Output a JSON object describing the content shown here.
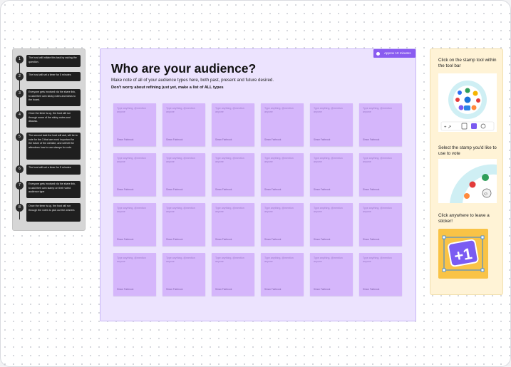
{
  "steps": [
    {
      "num": "1",
      "text": "The host will initiate this task by asking the question."
    },
    {
      "num": "2",
      "text": "The host will set a timer for 5 minutes"
    },
    {
      "num": "3",
      "text": "Everyone gets involved via the share link, to add their own sticky notes and ideas to the board."
    },
    {
      "num": "4",
      "text": "Once the timer is up, the host will run through some of the sticky notes and discuss."
    },
    {
      "num": "5",
      "text": "The second task the host will ask, will be to vote for the 3 that are most important for the future of the website, and will tell the attendees how to use stamps for vote."
    },
    {
      "num": "6",
      "text": "The host will set a timer for 5 minutes"
    },
    {
      "num": "7",
      "text": "Everyone gets involved via the share link, to add their own stamp on their voted audience type"
    },
    {
      "num": "8",
      "text": "Once the timer is up, the host will run through the votes to pick out the winners"
    }
  ],
  "frame": {
    "timer_label": "Approx 10 minutes",
    "title": "Who are your audience?",
    "subtitle": "Make note of all of your audience types here, both past, present and future desired.",
    "subtitle2": "Don't worry about refining just yet, make a list of ALL types"
  },
  "sticky": {
    "placeholder": "Type anything, @mention anyone",
    "author": "Simon Fairbrook",
    "count": 24,
    "color": "#d5b6fb"
  },
  "help": {
    "step1": "Click on the stamp tool within the tool bar",
    "step2": "Select the stamp you'd like to use to vote",
    "step3": "Click anywhere to leave a sticker!"
  },
  "colors": {
    "frame_bg": "#ece3fe",
    "accent": "#8a5cf0",
    "help_bg": "#fff3d6"
  }
}
